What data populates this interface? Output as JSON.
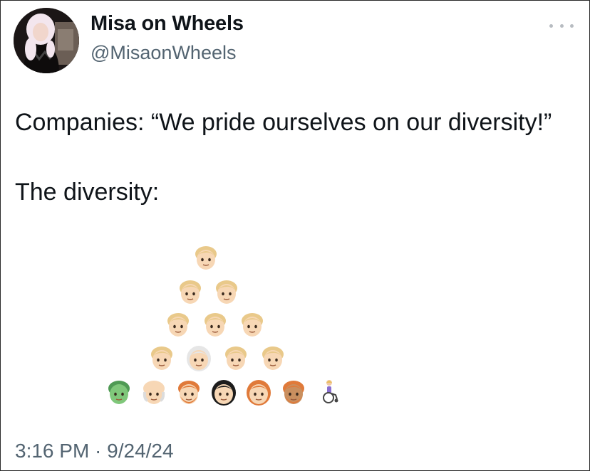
{
  "author": {
    "display_name": "Misa on Wheels",
    "handle": "@MisaonWheels",
    "avatar_icon": "profile-photo"
  },
  "more_icon": "ellipsis-icon",
  "tweet": {
    "line1": "Companies: “We pride ourselves on our diversity!”",
    "line2": "The diversity:"
  },
  "timestamp": "3:16 PM · 9/24/24",
  "emoji_pyramid": {
    "rows": [
      [
        "blond-man"
      ],
      [
        "blond-man",
        "blond-man"
      ],
      [
        "blond-man",
        "blond-man",
        "blond-man"
      ],
      [
        "blond-man",
        "white-haired-woman",
        "blond-man",
        "blond-man"
      ],
      [
        "zombie",
        "bald-man",
        "red-haired-man",
        "dark-haired-woman",
        "red-haired-woman",
        "red-haired-man-medium-skin",
        "person-in-wheelchair"
      ]
    ]
  },
  "colors": {
    "text": "#0f1419",
    "secondary_text": "#536471",
    "skin_light": "#f7d7b5",
    "hair_blond": "#e9c98a",
    "hair_red": "#e07a3a",
    "hair_dark": "#1c1c1c",
    "hair_white": "#e6e6e6",
    "zombie_green": "#7fc77a"
  }
}
